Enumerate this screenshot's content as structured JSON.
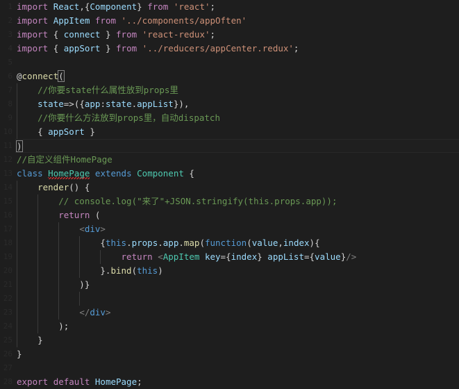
{
  "editor": {
    "theme": "VS Code Dark+",
    "language": "javascript",
    "background": "#1e1e1e",
    "foreground": "#d4d4d4",
    "cursor_line": 9,
    "colors": {
      "keyword_control": "#c586c0",
      "keyword": "#569cd6",
      "identifier": "#9cdcfe",
      "type": "#4ec9b0",
      "string": "#ce9178",
      "comment": "#6a9955",
      "plain": "#d4d4d4",
      "punctuation": "#808080",
      "error_squiggle": "#cc3333"
    },
    "lines": [
      {
        "n": 1,
        "indent": 0,
        "current": false,
        "tokens": [
          {
            "t": "import",
            "c": "kw"
          },
          {
            "t": " ",
            "c": "pl"
          },
          {
            "t": "React",
            "c": "id"
          },
          {
            "t": ",",
            "c": "pl"
          },
          {
            "t": "{",
            "c": "pl"
          },
          {
            "t": "Component",
            "c": "id"
          },
          {
            "t": "}",
            "c": "pl"
          },
          {
            "t": " ",
            "c": "pl"
          },
          {
            "t": "from",
            "c": "kw"
          },
          {
            "t": " ",
            "c": "pl"
          },
          {
            "t": "'react'",
            "c": "str"
          },
          {
            "t": ";",
            "c": "pl"
          }
        ]
      },
      {
        "n": 2,
        "indent": 0,
        "current": false,
        "tokens": [
          {
            "t": "import",
            "c": "kw"
          },
          {
            "t": " ",
            "c": "pl"
          },
          {
            "t": "AppItem",
            "c": "id"
          },
          {
            "t": " ",
            "c": "pl"
          },
          {
            "t": "from",
            "c": "kw"
          },
          {
            "t": " ",
            "c": "pl"
          },
          {
            "t": "'../components/appOften'",
            "c": "str"
          }
        ]
      },
      {
        "n": 3,
        "indent": 0,
        "current": false,
        "tokens": [
          {
            "t": "import",
            "c": "kw"
          },
          {
            "t": " ",
            "c": "pl"
          },
          {
            "t": "{ ",
            "c": "pl"
          },
          {
            "t": "connect",
            "c": "id"
          },
          {
            "t": " }",
            "c": "pl"
          },
          {
            "t": " ",
            "c": "pl"
          },
          {
            "t": "from",
            "c": "kw"
          },
          {
            "t": " ",
            "c": "pl"
          },
          {
            "t": "'react-redux'",
            "c": "str"
          },
          {
            "t": ";",
            "c": "pl"
          }
        ]
      },
      {
        "n": 4,
        "indent": 0,
        "current": false,
        "tokens": [
          {
            "t": "import",
            "c": "kw"
          },
          {
            "t": " ",
            "c": "pl"
          },
          {
            "t": "{ ",
            "c": "pl"
          },
          {
            "t": "appSort",
            "c": "id"
          },
          {
            "t": " }",
            "c": "pl"
          },
          {
            "t": " ",
            "c": "pl"
          },
          {
            "t": "from",
            "c": "kw"
          },
          {
            "t": " ",
            "c": "pl"
          },
          {
            "t": "'../reducers/appCenter.redux'",
            "c": "str"
          },
          {
            "t": ";",
            "c": "pl"
          }
        ]
      },
      {
        "n": 5,
        "indent": 0,
        "current": false,
        "tokens": []
      },
      {
        "n": 6,
        "indent": 0,
        "current": false,
        "tokens": [
          {
            "t": "@",
            "c": "pl"
          },
          {
            "t": "connect",
            "c": "fn"
          },
          {
            "t": "(",
            "c": "pl",
            "match": true
          }
        ]
      },
      {
        "n": 7,
        "indent": 1,
        "current": false,
        "tokens": [
          {
            "t": "    //你要state什么属性放到props里",
            "c": "cmt"
          }
        ]
      },
      {
        "n": 8,
        "indent": 1,
        "current": false,
        "tokens": [
          {
            "t": "    ",
            "c": "pl"
          },
          {
            "t": "state",
            "c": "id"
          },
          {
            "t": "=>",
            "c": "pl"
          },
          {
            "t": "({",
            "c": "pl"
          },
          {
            "t": "app",
            "c": "id"
          },
          {
            "t": ":",
            "c": "pl"
          },
          {
            "t": "state",
            "c": "id"
          },
          {
            "t": ".",
            "c": "pl"
          },
          {
            "t": "appList",
            "c": "id"
          },
          {
            "t": "})",
            "c": "pl"
          },
          {
            "t": ",",
            "c": "pl"
          }
        ]
      },
      {
        "n": 9,
        "indent": 1,
        "current": false,
        "tokens": [
          {
            "t": "    //你要什么方法放到props里，自动dispatch",
            "c": "cmt"
          }
        ]
      },
      {
        "n": 10,
        "indent": 1,
        "current": false,
        "tokens": [
          {
            "t": "    { ",
            "c": "pl"
          },
          {
            "t": "appSort",
            "c": "id"
          },
          {
            "t": " }",
            "c": "pl"
          }
        ]
      },
      {
        "n": 11,
        "indent": 0,
        "current": true,
        "tokens": [
          {
            "t": ")",
            "c": "pl",
            "match": true
          },
          {
            "t": "",
            "c": "caret"
          }
        ]
      },
      {
        "n": 12,
        "indent": 0,
        "current": false,
        "tokens": [
          {
            "t": "//自定义组件HomePage",
            "c": "cmt"
          }
        ]
      },
      {
        "n": 13,
        "indent": 0,
        "current": false,
        "tokens": [
          {
            "t": "class",
            "c": "kw2"
          },
          {
            "t": " ",
            "c": "pl"
          },
          {
            "t": "HomePage",
            "c": "type",
            "squiggle": true
          },
          {
            "t": " ",
            "c": "pl"
          },
          {
            "t": "extends",
            "c": "kw2"
          },
          {
            "t": " ",
            "c": "pl"
          },
          {
            "t": "Component",
            "c": "type"
          },
          {
            "t": " {",
            "c": "pl"
          }
        ]
      },
      {
        "n": 14,
        "indent": 1,
        "current": false,
        "tokens": [
          {
            "t": "    ",
            "c": "pl"
          },
          {
            "t": "render",
            "c": "fn"
          },
          {
            "t": "() {",
            "c": "pl"
          }
        ]
      },
      {
        "n": 15,
        "indent": 2,
        "current": false,
        "tokens": [
          {
            "t": "        // console.log(\"来了\"+JSON.stringify(this.props.app));",
            "c": "cmt"
          }
        ]
      },
      {
        "n": 16,
        "indent": 2,
        "current": false,
        "tokens": [
          {
            "t": "        ",
            "c": "pl"
          },
          {
            "t": "return",
            "c": "kw"
          },
          {
            "t": " (",
            "c": "pl"
          }
        ]
      },
      {
        "n": 17,
        "indent": 3,
        "current": false,
        "tokens": [
          {
            "t": "            ",
            "c": "pl"
          },
          {
            "t": "<",
            "c": "tag"
          },
          {
            "t": "div",
            "c": "kw2"
          },
          {
            "t": ">",
            "c": "tag"
          }
        ]
      },
      {
        "n": 18,
        "indent": 4,
        "current": false,
        "tokens": [
          {
            "t": "                ",
            "c": "pl"
          },
          {
            "t": "{",
            "c": "pl"
          },
          {
            "t": "this",
            "c": "kw2"
          },
          {
            "t": ".",
            "c": "pl"
          },
          {
            "t": "props",
            "c": "id"
          },
          {
            "t": ".",
            "c": "pl"
          },
          {
            "t": "app",
            "c": "id"
          },
          {
            "t": ".",
            "c": "pl"
          },
          {
            "t": "map",
            "c": "fn"
          },
          {
            "t": "(",
            "c": "pl"
          },
          {
            "t": "function",
            "c": "kw2"
          },
          {
            "t": "(",
            "c": "pl"
          },
          {
            "t": "value",
            "c": "id"
          },
          {
            "t": ",",
            "c": "pl"
          },
          {
            "t": "index",
            "c": "id"
          },
          {
            "t": "){",
            "c": "pl"
          }
        ]
      },
      {
        "n": 19,
        "indent": 5,
        "current": false,
        "tokens": [
          {
            "t": "                    ",
            "c": "pl"
          },
          {
            "t": "return",
            "c": "kw"
          },
          {
            "t": " ",
            "c": "pl"
          },
          {
            "t": "<",
            "c": "tag"
          },
          {
            "t": "AppItem",
            "c": "type"
          },
          {
            "t": " ",
            "c": "pl"
          },
          {
            "t": "key",
            "c": "id"
          },
          {
            "t": "=",
            "c": "pl"
          },
          {
            "t": "{",
            "c": "pl"
          },
          {
            "t": "index",
            "c": "id"
          },
          {
            "t": "}",
            "c": "pl"
          },
          {
            "t": " ",
            "c": "pl"
          },
          {
            "t": "appList",
            "c": "id"
          },
          {
            "t": "=",
            "c": "pl"
          },
          {
            "t": "{",
            "c": "pl"
          },
          {
            "t": "value",
            "c": "id"
          },
          {
            "t": "}",
            "c": "pl"
          },
          {
            "t": "/>",
            "c": "tag"
          }
        ]
      },
      {
        "n": 20,
        "indent": 4,
        "current": false,
        "tokens": [
          {
            "t": "                }.",
            "c": "pl"
          },
          {
            "t": "bind",
            "c": "fn"
          },
          {
            "t": "(",
            "c": "pl"
          },
          {
            "t": "this",
            "c": "kw2"
          },
          {
            "t": ")",
            "c": "pl"
          }
        ]
      },
      {
        "n": 21,
        "indent": 3,
        "current": false,
        "tokens": [
          {
            "t": "            )}",
            "c": "pl"
          }
        ]
      },
      {
        "n": 22,
        "indent": 4,
        "current": false,
        "tokens": []
      },
      {
        "n": 23,
        "indent": 3,
        "current": false,
        "tokens": [
          {
            "t": "            ",
            "c": "pl"
          },
          {
            "t": "</",
            "c": "tag"
          },
          {
            "t": "div",
            "c": "kw2"
          },
          {
            "t": ">",
            "c": "tag"
          }
        ]
      },
      {
        "n": 24,
        "indent": 2,
        "current": false,
        "tokens": [
          {
            "t": "        );",
            "c": "pl"
          }
        ]
      },
      {
        "n": 25,
        "indent": 1,
        "current": false,
        "tokens": [
          {
            "t": "    }",
            "c": "pl"
          }
        ]
      },
      {
        "n": 26,
        "indent": 0,
        "current": false,
        "tokens": [
          {
            "t": "}",
            "c": "pl"
          }
        ]
      },
      {
        "n": 27,
        "indent": 0,
        "current": false,
        "tokens": []
      },
      {
        "n": 28,
        "indent": 0,
        "current": false,
        "tokens": [
          {
            "t": "export",
            "c": "kw"
          },
          {
            "t": " ",
            "c": "pl"
          },
          {
            "t": "default",
            "c": "kw"
          },
          {
            "t": " ",
            "c": "pl"
          },
          {
            "t": "HomePage",
            "c": "id"
          },
          {
            "t": ";",
            "c": "pl"
          }
        ]
      }
    ]
  }
}
